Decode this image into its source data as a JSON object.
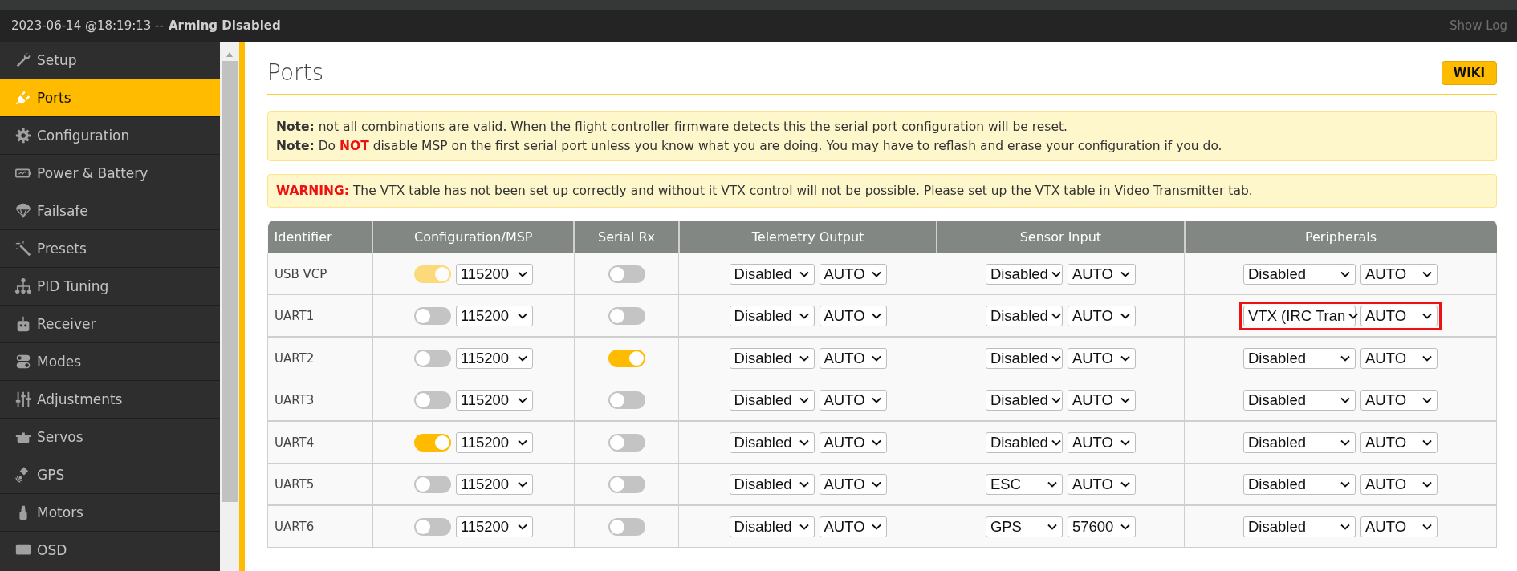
{
  "status_bar": {
    "timestamp": "2023-06-14 @18:19:13 --",
    "status": "Arming Disabled",
    "show_log": "Show Log"
  },
  "sidebar": {
    "items": [
      {
        "label": "Setup",
        "selected": false
      },
      {
        "label": "Ports",
        "selected": true
      },
      {
        "label": "Configuration",
        "selected": false
      },
      {
        "label": "Power & Battery",
        "selected": false
      },
      {
        "label": "Failsafe",
        "selected": false
      },
      {
        "label": "Presets",
        "selected": false
      },
      {
        "label": "PID Tuning",
        "selected": false
      },
      {
        "label": "Receiver",
        "selected": false
      },
      {
        "label": "Modes",
        "selected": false
      },
      {
        "label": "Adjustments",
        "selected": false
      },
      {
        "label": "Servos",
        "selected": false
      },
      {
        "label": "GPS",
        "selected": false
      },
      {
        "label": "Motors",
        "selected": false
      },
      {
        "label": "OSD",
        "selected": false
      }
    ]
  },
  "page": {
    "title": "Ports",
    "wiki": "WIKI"
  },
  "notes": [
    {
      "kind": "note",
      "parts": [
        {
          "kind": "label",
          "text": "Note:"
        },
        {
          "kind": "plain",
          "text": " not all combinations are valid. When the flight controller firmware detects this the serial port configuration will be reset."
        }
      ]
    },
    {
      "kind": "note",
      "parts": [
        {
          "kind": "label",
          "text": "Note:"
        },
        {
          "kind": "plain",
          "text": " Do "
        },
        {
          "kind": "alert",
          "text": "NOT"
        },
        {
          "kind": "plain",
          "text": " disable MSP on the first serial port unless you know what you are doing. You may have to reflash and erase your configuration if you do."
        }
      ]
    },
    {
      "kind": "warning",
      "parts": [
        {
          "kind": "alert",
          "text": "WARNING:"
        },
        {
          "kind": "plain",
          "text": " The VTX table has not been set up correctly and without it VTX control will not be possible. Please set up the VTX table in Video Transmitter tab."
        }
      ]
    }
  ],
  "table": {
    "columns": [
      "Identifier",
      "Configuration/MSP",
      "Serial Rx",
      "Telemetry Output",
      "Sensor Input",
      "Peripherals"
    ],
    "rows": [
      {
        "identifier": "USB VCP",
        "msp": {
          "checked": true,
          "disabled": true,
          "baud": "115200"
        },
        "serial_rx": {
          "checked": false
        },
        "telemetry": {
          "protocol": "Disabled",
          "baud": "AUTO"
        },
        "sensor": {
          "protocol": "Disabled",
          "baud": "AUTO"
        },
        "peripherals": {
          "protocol": "Disabled",
          "baud": "AUTO",
          "highlighted": false
        }
      },
      {
        "identifier": "UART1",
        "msp": {
          "checked": false,
          "disabled": false,
          "baud": "115200"
        },
        "serial_rx": {
          "checked": false
        },
        "telemetry": {
          "protocol": "Disabled",
          "baud": "AUTO"
        },
        "sensor": {
          "protocol": "Disabled",
          "baud": "AUTO"
        },
        "peripherals": {
          "protocol": "VTX (IRC Tran",
          "baud": "AUTO",
          "highlighted": true
        }
      },
      {
        "identifier": "UART2",
        "msp": {
          "checked": false,
          "disabled": false,
          "baud": "115200"
        },
        "serial_rx": {
          "checked": true
        },
        "telemetry": {
          "protocol": "Disabled",
          "baud": "AUTO"
        },
        "sensor": {
          "protocol": "Disabled",
          "baud": "AUTO"
        },
        "peripherals": {
          "protocol": "Disabled",
          "baud": "AUTO",
          "highlighted": false
        }
      },
      {
        "identifier": "UART3",
        "msp": {
          "checked": false,
          "disabled": false,
          "baud": "115200"
        },
        "serial_rx": {
          "checked": false
        },
        "telemetry": {
          "protocol": "Disabled",
          "baud": "AUTO"
        },
        "sensor": {
          "protocol": "Disabled",
          "baud": "AUTO"
        },
        "peripherals": {
          "protocol": "Disabled",
          "baud": "AUTO",
          "highlighted": false
        }
      },
      {
        "identifier": "UART4",
        "msp": {
          "checked": true,
          "disabled": false,
          "baud": "115200"
        },
        "serial_rx": {
          "checked": false
        },
        "telemetry": {
          "protocol": "Disabled",
          "baud": "AUTO"
        },
        "sensor": {
          "protocol": "Disabled",
          "baud": "AUTO"
        },
        "peripherals": {
          "protocol": "Disabled",
          "baud": "AUTO",
          "highlighted": false
        }
      },
      {
        "identifier": "UART5",
        "msp": {
          "checked": false,
          "disabled": false,
          "baud": "115200"
        },
        "serial_rx": {
          "checked": false
        },
        "telemetry": {
          "protocol": "Disabled",
          "baud": "AUTO"
        },
        "sensor": {
          "protocol": "ESC",
          "baud": "AUTO"
        },
        "peripherals": {
          "protocol": "Disabled",
          "baud": "AUTO",
          "highlighted": false
        }
      },
      {
        "identifier": "UART6",
        "msp": {
          "checked": false,
          "disabled": false,
          "baud": "115200"
        },
        "serial_rx": {
          "checked": false
        },
        "telemetry": {
          "protocol": "Disabled",
          "baud": "AUTO"
        },
        "sensor": {
          "protocol": "GPS",
          "baud": "57600"
        },
        "peripherals": {
          "protocol": "Disabled",
          "baud": "AUTO",
          "highlighted": false
        }
      }
    ]
  }
}
